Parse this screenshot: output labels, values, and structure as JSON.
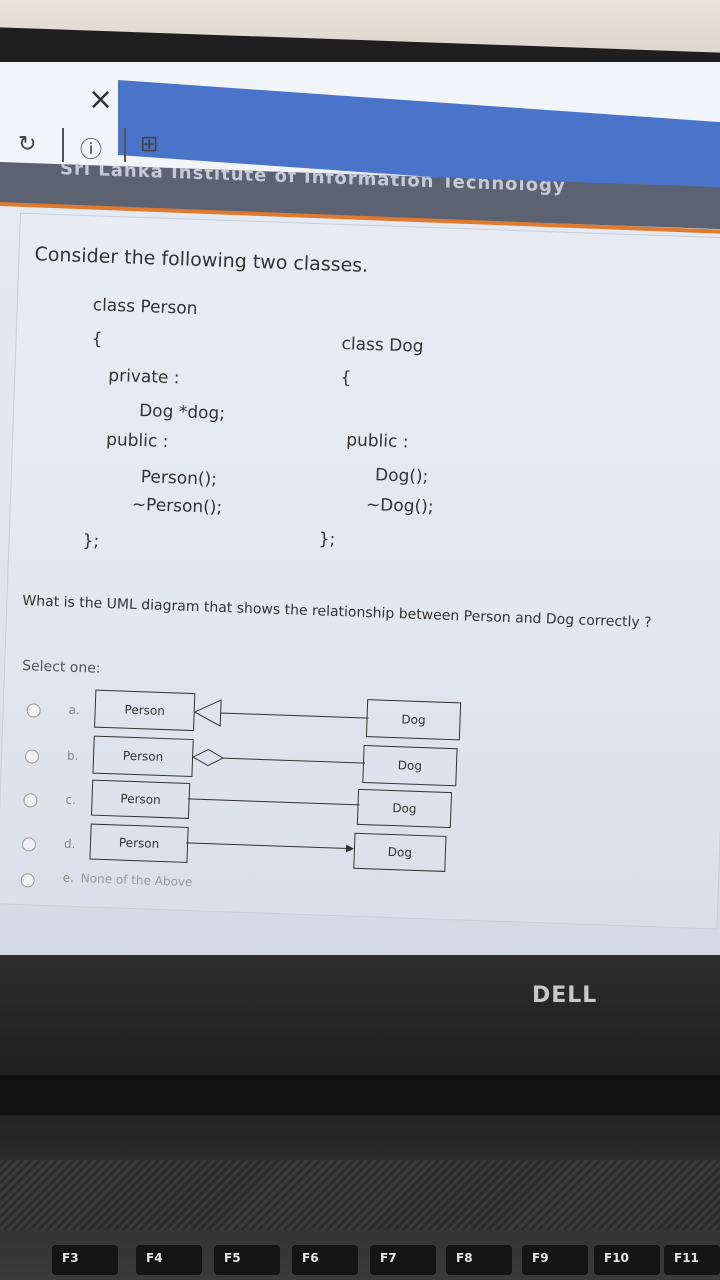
{
  "toolbar": {
    "close_icon": "×",
    "refresh_icon": "↻",
    "info_icon": "ⓘ",
    "add_icon": "⊞"
  },
  "site": {
    "name": "Sri Lanka Institute of Information Technology"
  },
  "question": {
    "intro": "Consider the following two classes.",
    "person_code": {
      "header": "class Person",
      "open": "{",
      "private": "private :",
      "member": "Dog *dog;",
      "public": "public :",
      "ctor": "Person();",
      "dtor": "~Person();",
      "close": "};"
    },
    "dog_code": {
      "header": "class Dog",
      "open": "{",
      "public": "public :",
      "ctor": "Dog();",
      "dtor": "~Dog();",
      "close": "};"
    },
    "prompt": "What is the UML diagram that shows the relationship between Person and Dog correctly ?",
    "select_label": "Select one:",
    "options": [
      {
        "letter": "a.",
        "left": "Person",
        "right": "Dog"
      },
      {
        "letter": "b.",
        "left": "Person",
        "right": "Dog"
      },
      {
        "letter": "c.",
        "left": "Person",
        "right": "Dog"
      },
      {
        "letter": "d.",
        "left": "Person",
        "right": "Dog"
      },
      {
        "letter": "e.",
        "text": "None of the Above"
      }
    ]
  },
  "laptop": {
    "brand": "DELL",
    "fkeys": [
      "F3",
      "F4",
      "F5",
      "F6",
      "F7",
      "F8",
      "F9",
      "F10",
      "F11"
    ]
  }
}
